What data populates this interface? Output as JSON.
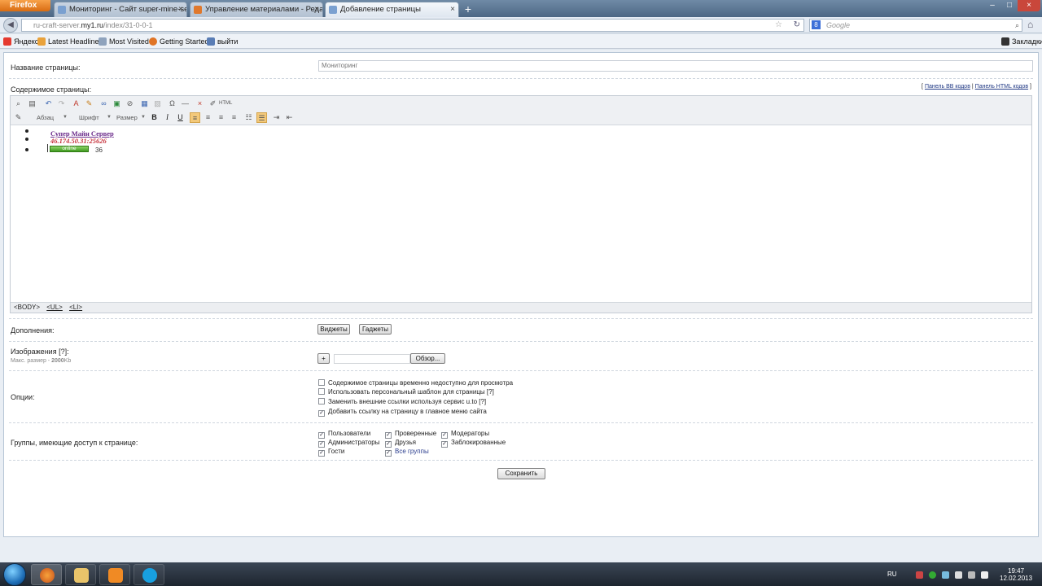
{
  "browser": {
    "menu_button": "Firefox",
    "tabs": [
      {
        "title": "Мониторинг - Сайт super-mine-serv...",
        "active": false,
        "favicon_color": "#7aa0d0"
      },
      {
        "title": "Управление материалами - Редакто...",
        "active": false,
        "favicon_color": "#e0782c"
      },
      {
        "title": "Добавление страницы",
        "active": true,
        "favicon_color": "#7aa0d0"
      }
    ],
    "new_tab": "+",
    "url_prefix": "ru-craft-server.",
    "url_domain": "my1.ru",
    "url_path": "/index/31-0-0-1",
    "search_placeholder": "Google",
    "bookmarks": [
      {
        "label": "Яндекс",
        "icon": "yandex-icon",
        "color": "#e53a2f"
      },
      {
        "label": "Latest Headlines",
        "icon": "rss-icon",
        "color": "#e9a23b"
      },
      {
        "label": "Most Visited",
        "icon": "bookmark-icon",
        "color": "#8fa3bd"
      },
      {
        "label": "Getting Started",
        "icon": "firefox-icon",
        "color": "#e07425"
      },
      {
        "label": "выйти",
        "icon": "bookmark-icon",
        "color": "#5a7db5"
      }
    ],
    "bookmarks_menu": "Закладки"
  },
  "form": {
    "page_title_label": "Название страницы:",
    "page_title_value": "Мониторинг",
    "content_label": "Содержимое страницы:",
    "panel_links": {
      "bb": "Панель BB кодов",
      "html": "Панель HTML кодов"
    },
    "toolbar_selects": {
      "paragraph": "Абзац",
      "font": "Шрифт",
      "size": "Размер"
    },
    "toolbar_buttons": {
      "bold": "B",
      "italic": "I",
      "underline": "U"
    },
    "editor_content": {
      "server_name": "Супер Майн Сервер",
      "server_ip": "46.174.50.31:25626",
      "server_status": "online",
      "server_number": "36"
    },
    "path_tags": [
      "<BODY>",
      "<UL>",
      "<LI>"
    ],
    "extras_label": "Дополнения:",
    "widgets_button": "Виджеты",
    "gadgets_button": "Гаджеты",
    "images_label": "Изображения",
    "images_help": "[?]",
    "images_hint_prefix": "Макс. размер - ",
    "images_hint_value": "2000",
    "images_hint_unit": "Kb",
    "add_button": "+",
    "browse_button": "Обзор...",
    "options_label": "Опции:",
    "options": [
      {
        "label": "Содержимое страницы временно недоступно для просмотра",
        "checked": false,
        "help": ""
      },
      {
        "label": "Использовать персональный шаблон для страницы",
        "checked": false,
        "help": "[?]"
      },
      {
        "label": "Заменить внешние ссылки используя сервис u.to",
        "checked": false,
        "help": "[?]"
      },
      {
        "label": "Добавить ссылку на страницу в главное меню сайта",
        "checked": true,
        "help": ""
      }
    ],
    "groups_label": "Группы, имеющие доступ к странице:",
    "groups": [
      {
        "label": "Пользователи",
        "checked": true
      },
      {
        "label": "Проверенные",
        "checked": true
      },
      {
        "label": "Модераторы",
        "checked": true
      },
      {
        "label": "Администраторы",
        "checked": true
      },
      {
        "label": "Друзья",
        "checked": true
      },
      {
        "label": "Заблокированные",
        "checked": true
      },
      {
        "label": "Гости",
        "checked": true
      },
      {
        "label": "Все группы",
        "checked": true
      }
    ],
    "save_button": "Сохранить"
  },
  "taskbar": {
    "language": "RU",
    "time": "19:47",
    "date": "12.02.2013"
  }
}
